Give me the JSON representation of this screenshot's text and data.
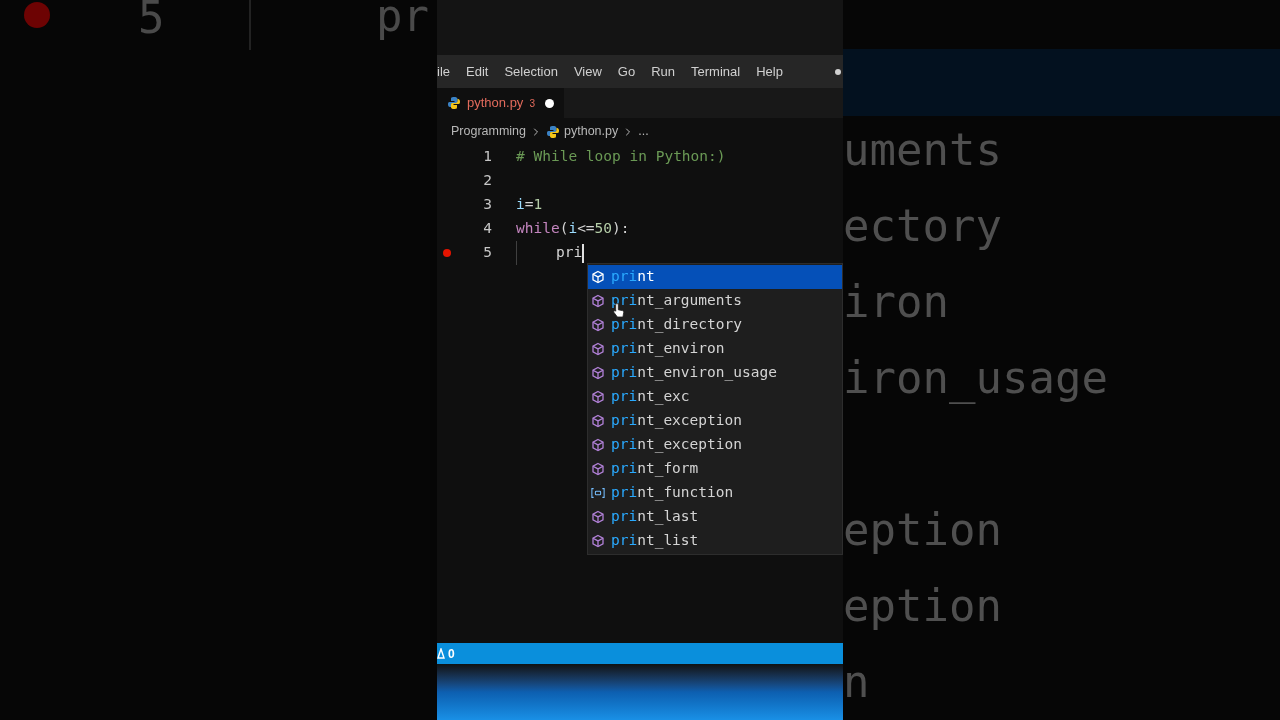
{
  "backdrop": {
    "left": {
      "breakpoint": true,
      "line_number": "5",
      "code": "pr"
    },
    "right_groups": [
      [
        "uments",
        "ectory",
        "iron",
        "iron_usage"
      ],
      [
        "eption",
        "eption",
        "n"
      ]
    ]
  },
  "menu": [
    "ile",
    "Edit",
    "Selection",
    "View",
    "Go",
    "Run",
    "Terminal",
    "Help"
  ],
  "tab": {
    "name": "python.py",
    "problems": "3",
    "modified": true
  },
  "breadcrumbs": [
    "Programming",
    "python.py",
    "..."
  ],
  "lines": [
    {
      "number": "1",
      "breakpoint": false,
      "indent": false,
      "cursor": false,
      "tokens": [
        {
          "text": "# While loop in Python:)",
          "kind": "comment"
        }
      ]
    },
    {
      "number": "2",
      "breakpoint": false,
      "indent": false,
      "cursor": false
    },
    {
      "number": "3",
      "breakpoint": false,
      "indent": false,
      "cursor": false,
      "tokens": [
        {
          "text": "i",
          "kind": "variable"
        },
        {
          "text": "=",
          "kind": "plain"
        },
        {
          "text": "1",
          "kind": "number"
        }
      ]
    },
    {
      "number": "4",
      "breakpoint": false,
      "indent": false,
      "cursor": false,
      "tokens": [
        {
          "text": "while",
          "kind": "keyword"
        },
        {
          "text": "(",
          "kind": "plain"
        },
        {
          "text": "i",
          "kind": "variable"
        },
        {
          "text": "<=",
          "kind": "plain"
        },
        {
          "text": "50",
          "kind": "number"
        },
        {
          "text": "):",
          "kind": "plain"
        }
      ]
    },
    {
      "number": "5",
      "breakpoint": true,
      "indent": true,
      "cursor": true,
      "tokens": [
        {
          "text": "pri",
          "kind": "plain"
        }
      ]
    }
  ],
  "suggestions": [
    {
      "match": "pri",
      "rest": "nt",
      "kind": "class",
      "selected": true
    },
    {
      "match": "pri",
      "rest": "nt_arguments",
      "kind": "class",
      "selected": false
    },
    {
      "match": "pri",
      "rest": "nt_directory",
      "kind": "class",
      "selected": false
    },
    {
      "match": "pri",
      "rest": "nt_environ",
      "kind": "class",
      "selected": false
    },
    {
      "match": "pri",
      "rest": "nt_environ_usage",
      "kind": "class",
      "selected": false
    },
    {
      "match": "pri",
      "rest": "nt_exc",
      "kind": "class",
      "selected": false
    },
    {
      "match": "pri",
      "rest": "nt_exception",
      "kind": "class",
      "selected": false
    },
    {
      "match": "pri",
      "rest": "nt_exception",
      "kind": "class",
      "selected": false
    },
    {
      "match": "pri",
      "rest": "nt_form",
      "kind": "class",
      "selected": false
    },
    {
      "match": "pri",
      "rest": "nt_function",
      "kind": "variable",
      "selected": false
    },
    {
      "match": "pri",
      "rest": "nt_last",
      "kind": "class",
      "selected": false
    },
    {
      "match": "pri",
      "rest": "nt_list",
      "kind": "class",
      "selected": false
    }
  ],
  "status_bar": {
    "warnings": "0"
  }
}
